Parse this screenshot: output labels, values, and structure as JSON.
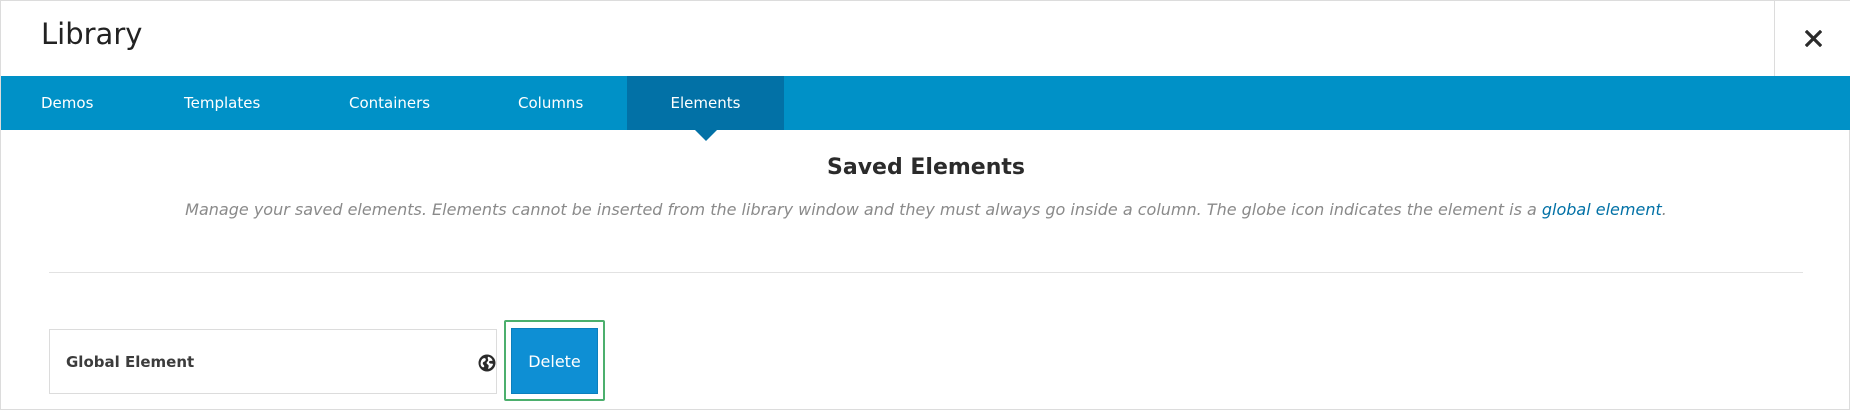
{
  "header": {
    "title": "Library",
    "close_icon": "close-icon"
  },
  "tabs": [
    {
      "label": "Demos",
      "active": false
    },
    {
      "label": "Templates",
      "active": false
    },
    {
      "label": "Containers",
      "active": false
    },
    {
      "label": "Columns",
      "active": false
    },
    {
      "label": "Elements",
      "active": true
    }
  ],
  "main": {
    "section_title": "Saved Elements",
    "description_text": "Manage your saved elements. Elements cannot be inserted from the library window and they must always go inside a column. The globe icon indicates the element is a ",
    "description_link": "global element",
    "description_end": ".",
    "saved_elements": [
      {
        "label": "Global Element",
        "icon": "globe-icon",
        "delete_label": "Delete"
      }
    ]
  },
  "colors": {
    "tab_bar": "#0091c7",
    "active_tab": "#0271a6",
    "delete_button": "#0e8fd4",
    "focus_outline": "#4caf6d",
    "link": "#0271a6"
  }
}
